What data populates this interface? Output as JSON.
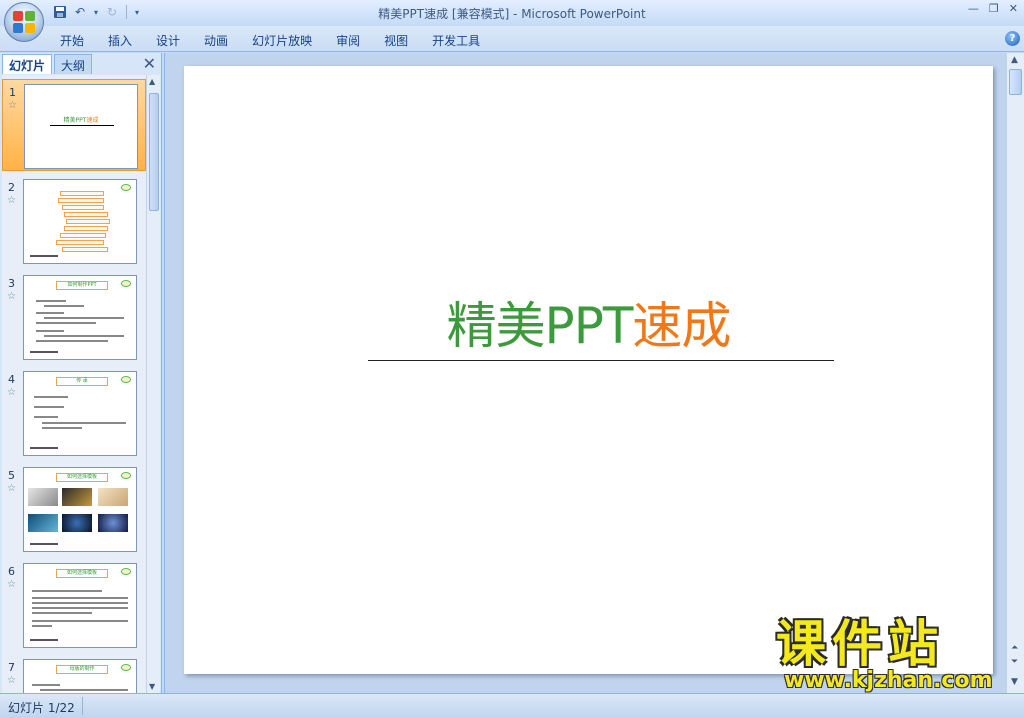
{
  "window": {
    "title": "精美PPT速成 [兼容模式] - Microsoft PowerPoint"
  },
  "ribbon": {
    "tabs": [
      "开始",
      "插入",
      "设计",
      "动画",
      "幻灯片放映",
      "审阅",
      "视图",
      "开发工具"
    ]
  },
  "left_pane": {
    "tabs": [
      "幻灯片",
      "大纲"
    ],
    "thumbnails": [
      {
        "number": "1",
        "title_green": "精美PPT",
        "title_orange": "速成"
      },
      {
        "number": "2"
      },
      {
        "number": "3",
        "heading": "如何制作PPT"
      },
      {
        "number": "4",
        "heading": "传 承"
      },
      {
        "number": "5",
        "heading": "如何选择模板"
      },
      {
        "number": "6",
        "heading": "如何选择模板"
      },
      {
        "number": "7",
        "heading": "母版的制作"
      }
    ]
  },
  "slide": {
    "title_green": "精美PPT",
    "title_orange": "速成"
  },
  "status": {
    "slide_counter": "幻灯片 1/22"
  },
  "watermark": {
    "title": "课件站",
    "url": "www.kjzhan.com"
  },
  "colors": {
    "accent_green": "#3c9a3c",
    "accent_orange": "#f07818",
    "selection": "#ffb347"
  }
}
